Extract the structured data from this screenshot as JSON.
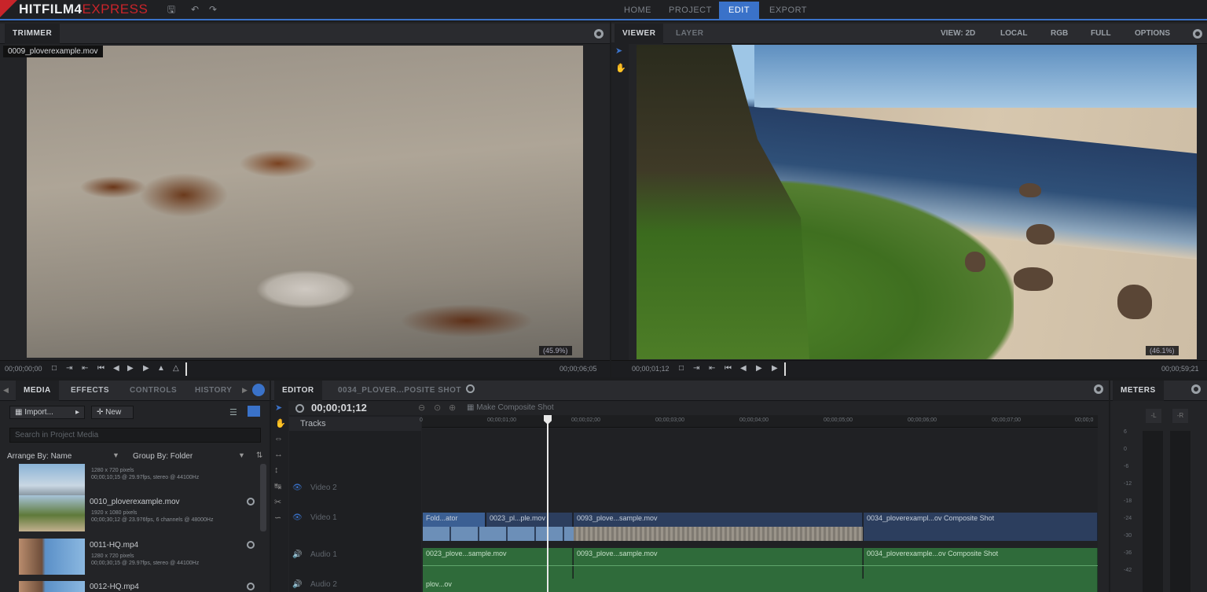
{
  "app": {
    "title_main": "HITFILM4",
    "title_express": "EXPRESS"
  },
  "toolbar": {
    "save_icon": "save-icon",
    "undo_icon": "undo-icon",
    "redo_icon": "redo-icon"
  },
  "nav": {
    "tabs": [
      "HOME",
      "PROJECT",
      "EDIT",
      "EXPORT"
    ],
    "active": "EDIT"
  },
  "trimmer": {
    "tab": "TRIMMER",
    "clip_name": "0009_ploverexample.mov",
    "zoom": "(45.9%)",
    "timecode_start": "00;00;00;00",
    "timecode_end": "00;00;06;05"
  },
  "viewer": {
    "tabs": [
      "VIEWER",
      "LAYER"
    ],
    "options": [
      "VIEW: 2D",
      "LOCAL",
      "RGB",
      "FULL",
      "OPTIONS"
    ],
    "zoom": "(46.1%)",
    "timecode_start": "00;00;01;12",
    "timecode_end": "00;00;59;21"
  },
  "media": {
    "tabs": [
      "MEDIA",
      "EFFECTS",
      "CONTROLS",
      "HISTORY"
    ],
    "import_label": "Import...",
    "new_label": "New",
    "search_placeholder": "Search in Project Media",
    "arrange_label": "Arrange By: Name",
    "group_label": "Group By: Folder",
    "items": [
      {
        "name": "",
        "info1": "1280 x 720 pixels",
        "info2": "00;00;10;15 @ 29.97fps, stereo @ 44100Hz"
      },
      {
        "name": "0010_ploverexample.mov",
        "info1": "1920 x 1080 pixels",
        "info2": "00;00;30;12 @ 23.976fps, 6 channels @ 48000Hz"
      },
      {
        "name": "0011-HQ.mp4",
        "info1": "1280 x 720 pixels",
        "info2": "00;00;30;15 @ 29.97fps, stereo @ 44100Hz"
      },
      {
        "name": "0012-HQ.mp4",
        "info1": "",
        "info2": ""
      }
    ]
  },
  "editor": {
    "tabs": [
      "EDITOR",
      "0034_PLOVER...POSITE SHOT"
    ],
    "timecode": "00;00;01;12",
    "make_composite": "Make Composite Shot",
    "tracks_label": "Tracks",
    "ruler": [
      "00;00;01;00",
      "00;00;02;00",
      "00;00;03;00",
      "00;00;04;00",
      "00;00;05;00",
      "00;00;06;00",
      "00;00;07;00",
      "00;00;0"
    ],
    "tracks": [
      {
        "name": "Video 2",
        "type": "video"
      },
      {
        "name": "Video 1",
        "type": "video"
      },
      {
        "name": "Audio 1",
        "type": "audio"
      },
      {
        "name": "Audio 2",
        "type": "audio"
      }
    ],
    "video1_clips": [
      "Fold...ator",
      "0023_pl...ple.mov",
      "0093_plove...sample.mov",
      "0034_ploverexampl...ov Composite Shot"
    ],
    "audio1_clips": [
      "0023_plove...sample.mov",
      "0093_plove...sample.mov",
      "0034_ploverexample...ov Composite Shot"
    ],
    "audio2_clips": [
      "plov...ov"
    ]
  },
  "meters": {
    "tab": "METERS",
    "channels": [
      "-L",
      "-R"
    ],
    "scale": [
      "6",
      "0",
      "-6",
      "-12",
      "-18",
      "-24",
      "-30",
      "-36",
      "-42"
    ]
  },
  "colors": {
    "accent": "#3a72c9",
    "brand": "#c8242a",
    "video_clip": "#2c3e5e",
    "audio_clip": "#2f6b3a"
  }
}
